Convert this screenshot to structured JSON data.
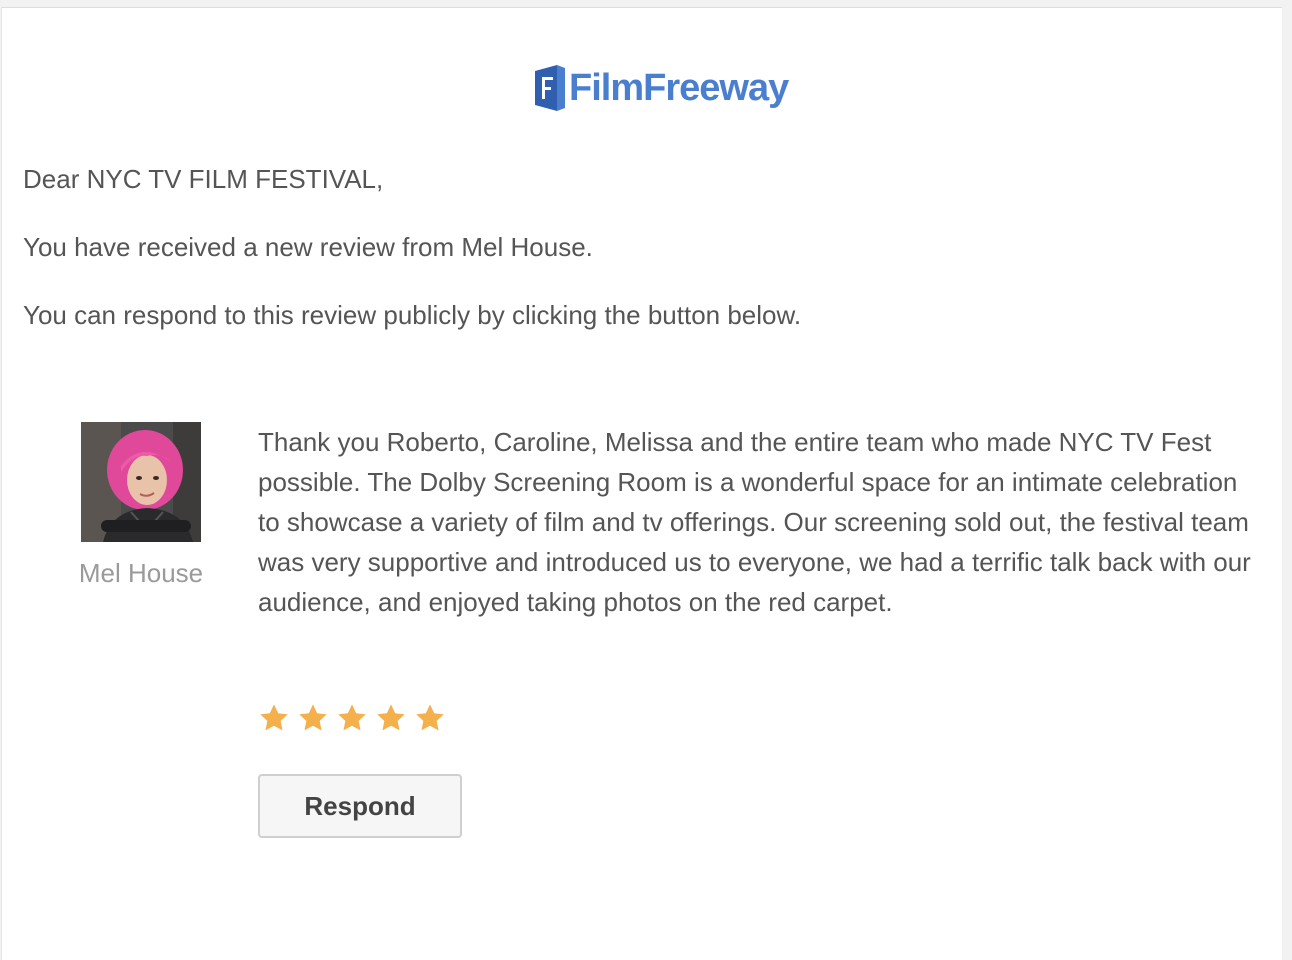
{
  "brand": {
    "logo_text": "FilmFreeway",
    "icon": "filmfreeway-door-icon",
    "color": "#4a7fcf"
  },
  "email": {
    "greeting": "Dear NYC TV FILM FESTIVAL,",
    "line1": "You have received a new review from Mel House.",
    "line2": "You can respond to this review publicly by clicking the button below."
  },
  "review": {
    "reviewer_name": "Mel House",
    "avatar_icon": "reviewer-photo",
    "text": "Thank you Roberto, Caroline, Melissa and the entire team who made NYC TV Fest possible. The Dolby Screening Room is a wonderful space for an intimate celebration to showcase a variety of film and tv offerings. Our screening sold out, the festival team was very supportive and introduced us to everyone, we had a terrific talk back with our audience, and enjoyed taking photos on the red carpet.",
    "rating": 5,
    "rating_max": 5,
    "star_color": "#f4b04a",
    "respond_label": "Respond"
  }
}
